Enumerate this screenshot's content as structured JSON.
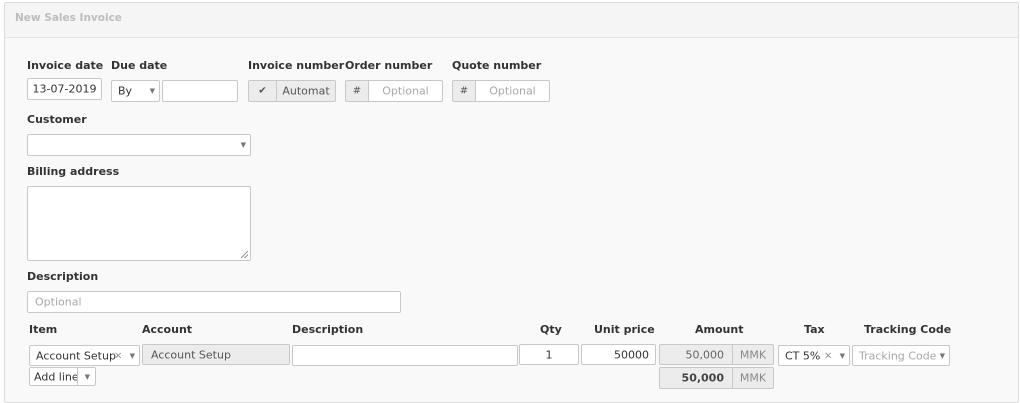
{
  "title": "New Sales Invoice",
  "labels": {
    "invoice_date": "Invoice date",
    "due_date": "Due date",
    "invoice_number": "Invoice number",
    "order_number": "Order number",
    "quote_number": "Quote number",
    "customer": "Customer",
    "billing_address": "Billing address",
    "description": "Description"
  },
  "fields": {
    "invoice_date": "13-07-2019",
    "due_date_mode": "By",
    "due_date_value": "",
    "invoice_number": "Automat",
    "invoice_number_auto_checked": true,
    "hash_symbol": "#",
    "order_number_placeholder": "Optional",
    "quote_number_placeholder": "Optional",
    "customer": "",
    "billing_address": "",
    "description_placeholder": "Optional"
  },
  "lines_table": {
    "columns": [
      "Item",
      "Account",
      "Description",
      "Qty",
      "Unit price",
      "Amount",
      "Tax",
      "Tracking Code"
    ],
    "rows": [
      {
        "item": "Account Setup",
        "account": "Account Setup",
        "description": "",
        "qty": "1",
        "unit_price": "50000",
        "amount": "50,000",
        "currency": "MMK",
        "tax": "CT 5%",
        "tracking_code_placeholder": "Tracking Code"
      }
    ],
    "add_line_label": "Add line",
    "total_amount": "50,000",
    "total_currency": "MMK"
  },
  "icons": {
    "check": "check-icon",
    "caret": "chevron-down-icon",
    "clear": "close-icon"
  }
}
